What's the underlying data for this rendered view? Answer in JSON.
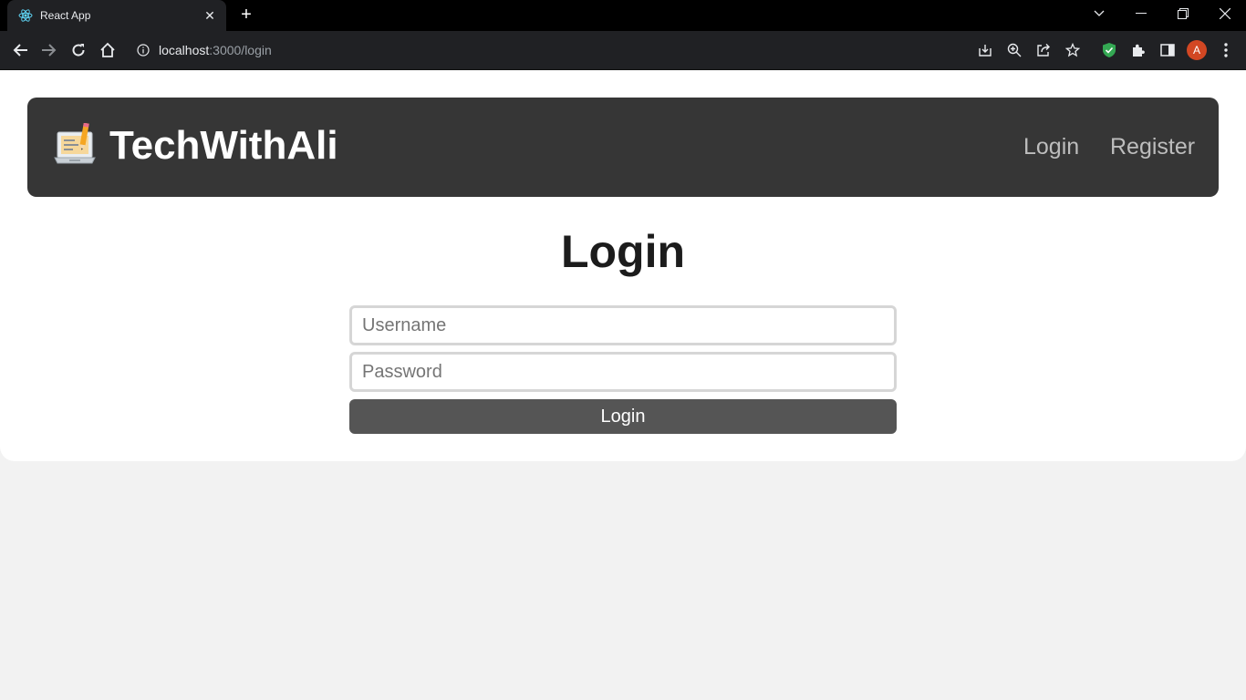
{
  "browser": {
    "tab_title": "React App",
    "url_host": "localhost",
    "url_path": ":3000/login",
    "profile_initial": "A",
    "colors": {
      "avatar": "#d24723",
      "shield": "#34a853"
    }
  },
  "navbar": {
    "brand": "TechWithAli",
    "brand_icon": "laptop-pencil-icon",
    "links": [
      "Login",
      "Register"
    ]
  },
  "form": {
    "title": "Login",
    "username_placeholder": "Username",
    "password_placeholder": "Password",
    "submit_label": "Login"
  }
}
